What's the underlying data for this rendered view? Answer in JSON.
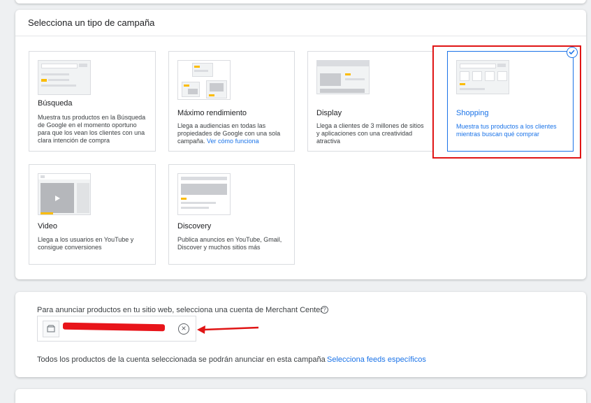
{
  "campaign_type": {
    "title": "Selecciona un tipo de campaña",
    "cards": [
      {
        "id": "busqueda",
        "label": "Búsqueda",
        "desc": "Muestra tus productos en la Búsqueda de Google en el momento oportuno para que los vean los clientes con una clara intención de compra",
        "selected": false
      },
      {
        "id": "maximo",
        "label": "Máximo rendimiento",
        "desc": "Llega a audiencias en todas las propiedades de Google con una sola campaña.",
        "link": "Ver cómo funciona",
        "selected": false
      },
      {
        "id": "display",
        "label": "Display",
        "desc": "Llega a clientes de 3 millones de sitios y aplicaciones con una creatividad atractiva",
        "selected": false
      },
      {
        "id": "shopping",
        "label": "Shopping",
        "desc": "Muestra tus productos a los clientes mientras buscan qué comprar",
        "selected": true
      },
      {
        "id": "video",
        "label": "Video",
        "desc": "Llega a los usuarios en YouTube y consigue conversiones",
        "selected": false
      },
      {
        "id": "discovery",
        "label": "Discovery",
        "desc": "Publica anuncios en YouTube, Gmail, Discover y muchos sitios más",
        "selected": false
      }
    ]
  },
  "merchant": {
    "label": "Para anunciar productos en tu sitio web, selecciona una cuenta de Merchant Center",
    "help_icon": "help-circle-icon",
    "account_name": "",
    "all_products_text": "Todos los productos de la cuenta seleccionada se podrán anunciar en esta campaña",
    "feeds_link": "Selecciona feeds específicos"
  },
  "colors": {
    "accent": "#1a73e8",
    "highlight": "#e01515",
    "yellow": "#fbbc04"
  }
}
